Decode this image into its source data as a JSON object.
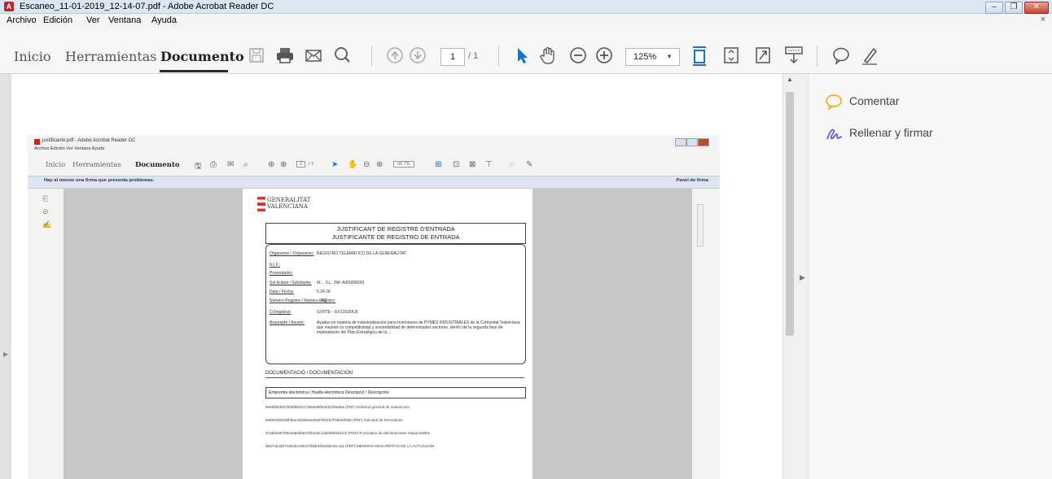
{
  "window": {
    "title": "Escaneo_11-01-2019_12-14-07.pdf - Adobe Acrobat Reader DC",
    "minimize": "–",
    "restore": "❐",
    "close": "✕"
  },
  "menu": {
    "items": [
      "Archivo",
      "Edición",
      "Ver",
      "Ventana",
      "Ayuda"
    ],
    "close": "×"
  },
  "tabs": [
    {
      "label": "Inicio"
    },
    {
      "label": "Herramientas"
    },
    {
      "label": "Documento"
    }
  ],
  "toolbar": {
    "page_value": "1",
    "page_total": "/ 1",
    "zoom_value": "125%",
    "zoom_caret": "▼"
  },
  "right_panel": {
    "items": [
      {
        "label": "Comentar",
        "icon": "comment-icon"
      },
      {
        "label": "Rellenar y firmar",
        "icon": "fill-sign-icon"
      }
    ]
  },
  "scan": {
    "title": "justificante.pdf - Adobe Acrobat Reader DC",
    "menu": "Archivo   Edición   Ver   Ventana   Ayuda",
    "tabs": [
      "Inicio",
      "Herramientas",
      "Documento"
    ],
    "page_value": "1",
    "page_total": "/ 7",
    "zoom_value": "66,7%",
    "warning": "Hay al menos una firma que presenta problemas.",
    "signature_panel": "Panel de firma",
    "logo_line1": "GENERALITAT",
    "logo_line2": "VALENCIANA",
    "heading_line1": "JUSTIFICANT DE REGISTRE D'ENTRADA",
    "heading_line2": "JUSTIFICANTE DE REGISTRO DE ENTRADA",
    "fields": [
      {
        "key": "Organisme / Organismo:",
        "value": "REGISTRO TELEMÁTICO DE LA GENERALITAT"
      },
      {
        "key": "N.I.F.:",
        "value": ""
      },
      {
        "key": "Presentador:",
        "value": ""
      },
      {
        "key": "Sol·licitant / Solicitante:",
        "value": "M… S.L. (Nif: A00000000)"
      },
      {
        "key": "Data / Fecha:",
        "value": "5.24.26"
      },
      {
        "key": "Número Registre / Número Registro:",
        "value": "…/62"
      },
      {
        "key": "O.Registral:",
        "value": "GVRTE - GV13SU0U5"
      },
      {
        "key": "Assumpte / Asunto:",
        "value": "Ayudas en materia de industrialización para inversiones de PYMES INDUSTRIALES de la Comunitat Valenciana que mejoren la competitividad y sostenibilidad de determinados sectores, dentro de la segunda fase de implantación del Plan Estratégico de la ..."
      }
    ],
    "docs_title": "DOCUMENTACIÓ / DOCUMENTACIÓN",
    "docs_header": "Empremta electrònica / Huella electrónica     Descripció / Descripción",
    "docs": [
      "9e50f5b3527bb9f6b2017d59a09f0e0d31f8e80a   (PDF)-Solicitud general de subvención",
      "5a8053d4b28f4bac9d2650a25a079d1b7f7d6e5f0a5   (PDF)-Solicitud de formularios",
      "87a5b3497b9a4a5d3b8702ba2bc1ab0f5b82d1c0   (PDF)-Formulario de declaraciones responsables",
      "0b57454d9742b2be1f6c67f55bd4f2e68c94c111   (PDF)-MEMORIA DESCRIPTIVA DE LA ACTUACIÓN"
    ]
  }
}
